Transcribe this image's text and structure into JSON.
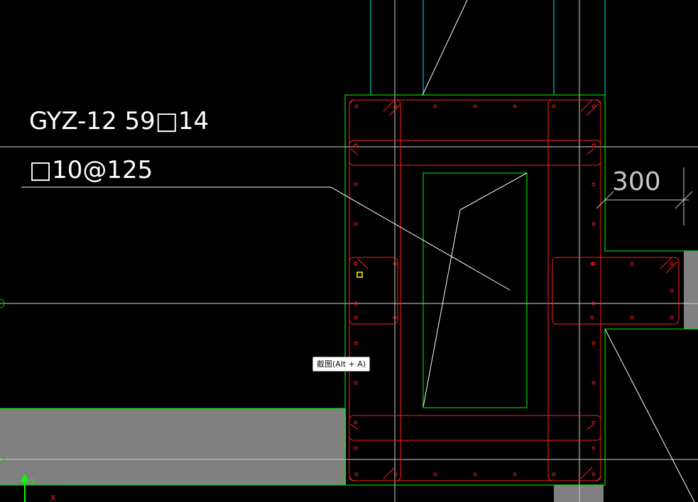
{
  "annotation": {
    "column_label": "GYZ-12 59□14",
    "stirrup_label": "□10@125"
  },
  "dimension": {
    "value": "300"
  },
  "tooltip": {
    "text": "截图(Alt + A)"
  },
  "ucs": {
    "y_label": "Y",
    "x_label": "X"
  },
  "colors": {
    "background": "#000000",
    "wall_outline": "#00ff00",
    "rebar": "#ff2020",
    "aux_line": "#00e5e5",
    "leader": "#ffffff",
    "axis_line": "#cfcfcf",
    "hatch": "#808080",
    "dimension_text": "#c8c8c8",
    "cursor": "#ffff00"
  },
  "icons": [
    "crosshair-cursor-icon",
    "ucs-axis-icon"
  ]
}
